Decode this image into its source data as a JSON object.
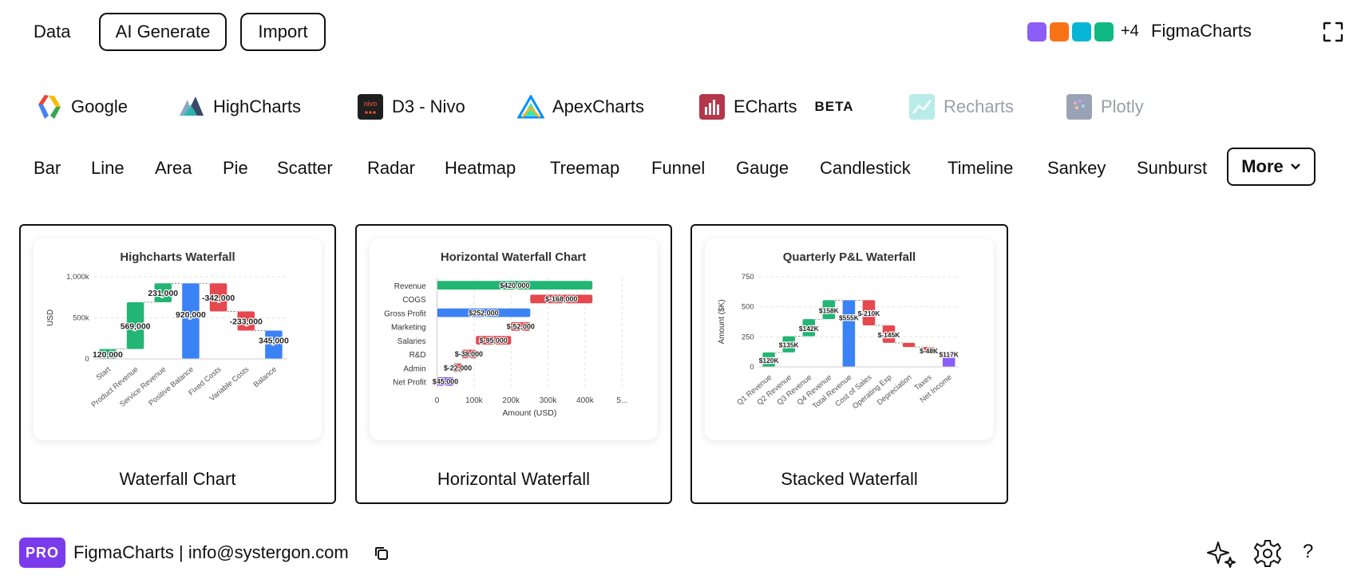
{
  "topbar": {
    "data_label": "Data",
    "ai_generate_label": "AI Generate",
    "import_label": "Import",
    "swatch_colors": [
      "#8b5cf6",
      "#f97316",
      "#06b6d4",
      "#10b981"
    ],
    "more_count": "+4",
    "brand": "FigmaCharts"
  },
  "libraries": [
    {
      "label": "Google",
      "icon": "google-icon"
    },
    {
      "label": "HighCharts",
      "icon": "highcharts-icon"
    },
    {
      "label": "D3 - Nivo",
      "icon": "nivo-icon",
      "icon_text": "nivo"
    },
    {
      "label": "ApexCharts",
      "icon": "apexcharts-icon"
    },
    {
      "label": "ECharts",
      "icon": "echarts-icon",
      "badge": "BETA"
    },
    {
      "label": "Recharts",
      "icon": "recharts-icon",
      "disabled": true
    },
    {
      "label": "Plotly",
      "icon": "plotly-icon",
      "disabled": true
    }
  ],
  "chart_types": [
    "Bar",
    "Line",
    "Area",
    "Pie",
    "Scatter",
    "Radar",
    "Heatmap",
    "Treemap",
    "Funnel",
    "Gauge",
    "Candlestick",
    "Timeline",
    "Sankey",
    "Sunburst"
  ],
  "more_label": "More",
  "colors": {
    "positive": "#22b573",
    "negative": "#e5484d",
    "total": "#3b82f6",
    "final": "#8b5cf6"
  },
  "cards": [
    {
      "caption": "Waterfall Chart"
    },
    {
      "caption": "Horizontal Waterfall"
    },
    {
      "caption": "Stacked Waterfall"
    }
  ],
  "chart_data": [
    {
      "type": "bar",
      "subtype": "waterfall",
      "title": "Highcharts Waterfall",
      "ylabel": "USD",
      "yticks": [
        "0",
        "500k",
        "1,000k"
      ],
      "ylim": [
        0,
        1000000
      ],
      "categories": [
        "Start",
        "Product Revenue",
        "Service Revenue",
        "Positive Balance",
        "Fixed Costs",
        "Variable Costs",
        "Balance"
      ],
      "values": [
        120000,
        569000,
        231000,
        920000,
        -342000,
        -233000,
        345000
      ],
      "labels": [
        "120,000",
        "569,000",
        "231,000",
        "920,000",
        "-342,000",
        "-233,000",
        "345,000"
      ],
      "kinds": [
        "positive",
        "positive",
        "positive",
        "total",
        "negative",
        "negative",
        "total"
      ]
    },
    {
      "type": "bar",
      "subtype": "horizontal-waterfall",
      "title": "Horizontal Waterfall Chart",
      "xlabel": "Amount (USD)",
      "xticks": [
        "0",
        "100k",
        "200k",
        "300k",
        "400k",
        "5..."
      ],
      "xlim": [
        0,
        500000
      ],
      "categories": [
        "Revenue",
        "COGS",
        "Gross Profit",
        "Marketing",
        "Salaries",
        "R&D",
        "Admin",
        "Net Profit"
      ],
      "values": [
        420000,
        -168000,
        252000,
        -52000,
        -95000,
        -38000,
        -22000,
        45000
      ],
      "labels": [
        "$420,000",
        "$-168,000",
        "$252,000",
        "$-52,000",
        "$-95,000",
        "$-38,000",
        "$-22,000",
        "$45,000"
      ],
      "kinds": [
        "positive",
        "negative",
        "total",
        "negative",
        "negative",
        "negative",
        "negative",
        "final"
      ]
    },
    {
      "type": "bar",
      "subtype": "waterfall",
      "title": "Quarterly P&L Waterfall",
      "ylabel": "Amount ($K)",
      "yticks": [
        "0",
        "250",
        "500",
        "750"
      ],
      "ylim": [
        0,
        750
      ],
      "categories": [
        "Q1 Revenue",
        "Q2 Revenue",
        "Q3 Revenue",
        "Q4 Revenue",
        "Total Revenue",
        "Cost of Sales",
        "Operating Exp",
        "Depreciation",
        "Taxes",
        "Net Income"
      ],
      "values": [
        120,
        135,
        142,
        158,
        555,
        -210,
        -145,
        -35,
        -48,
        117
      ],
      "labels": [
        "$120K",
        "$135K",
        "$142K",
        "$158K",
        "$555K",
        "$-210K",
        "$-145K",
        "",
        "$-48K",
        "$117K"
      ],
      "kinds": [
        "positive",
        "positive",
        "positive",
        "positive",
        "total",
        "negative",
        "negative",
        "negative",
        "negative",
        "final"
      ]
    }
  ],
  "footer": {
    "badge": "PRO",
    "text": "FigmaCharts | info@systergon.com"
  }
}
